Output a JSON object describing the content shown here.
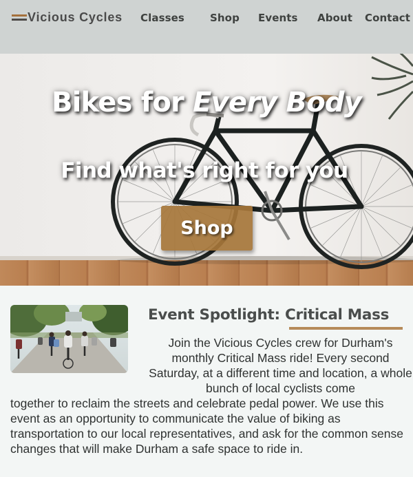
{
  "brand": {
    "name": "Vicious Cycles",
    "logo_icon": "two-stripe-logo-icon"
  },
  "nav": {
    "items": [
      {
        "label": "Classes"
      },
      {
        "label": "Shop"
      },
      {
        "label": "Events"
      },
      {
        "label": "About"
      },
      {
        "label": "Contact"
      }
    ]
  },
  "hero": {
    "title_plain": "Bikes for ",
    "title_emphasis": "Every Body",
    "subtitle": "Find what's right for you",
    "button_label": "Shop"
  },
  "event": {
    "heading_prefix": "Event Spotlight: ",
    "heading_highlight": "Critical Mass",
    "text_right": "Join the Vicious Cycles crew for Durham's monthly Critical Mass ride! Every second Saturday, at a different time and location, a whole bunch of local cyclists come",
    "text_full": "together to reclaim the streets and celebrate pedal power. We use this event as an opportunity to communicate the value of biking as transportation to our local representatives, and ask for the common sense changes that will make Durham a safe space to ride in."
  },
  "colors": {
    "accent": "#a6763a",
    "nav_bg": "#cfd3d2",
    "page_bg": "#f3f6f5"
  }
}
